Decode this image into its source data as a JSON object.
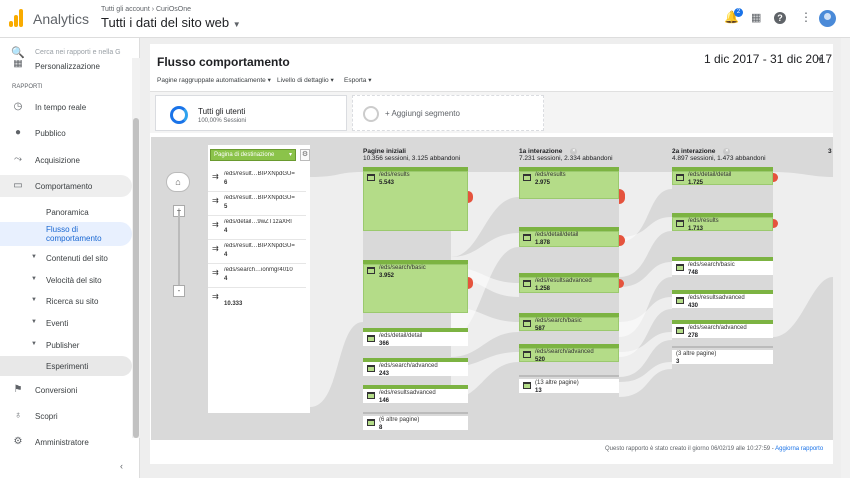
{
  "topbar": {
    "app_name": "Analytics",
    "breadcrumb": "Tutti gli account › CuriOsOne",
    "view_title": "Tutti i dati del sito web",
    "notifications_count": "2"
  },
  "sidebar": {
    "search_placeholder": "Cerca nei rapporti e nella G",
    "personalizzazione": "Personalizzazione",
    "section_label": "RAPPORTI",
    "items": [
      {
        "label": "In tempo reale",
        "icon": "clock-icon"
      },
      {
        "label": "Pubblico",
        "icon": "person-icon"
      },
      {
        "label": "Acquisizione",
        "icon": "acquisition-icon"
      },
      {
        "label": "Comportamento",
        "icon": "behavior-icon"
      }
    ],
    "behavior_sub": [
      "Panoramica",
      "Flusso di comportamento"
    ],
    "behavior_groups": [
      "Contenuti del sito",
      "Velocità del sito",
      "Ricerca su sito",
      "Eventi",
      "Publisher"
    ],
    "experiments": "Esperimenti",
    "bottom_items": [
      {
        "label": "Conversioni",
        "icon": "flag-icon"
      },
      {
        "label": "Scopri",
        "icon": "lightbulb-icon"
      },
      {
        "label": "Amministratore",
        "icon": "gear-icon"
      }
    ]
  },
  "report": {
    "title": "Flusso comportamento",
    "date_range": "1 dic 2017 - 31 dic 2017",
    "options": [
      "Pagine raggruppate automaticamente",
      "Livello di dettaglio",
      "Esporta"
    ],
    "segment_all": "Tutti gli utenti",
    "segment_all_sub": "100,00% Sessioni",
    "segment_add": "+ Aggiungi segmento",
    "dimension_select": "Pagina di destinazione",
    "sources": [
      {
        "name": "/eds/result…BIPXNpdGU=",
        "value": "6"
      },
      {
        "name": "/eds/result…BIPXNpdGU=",
        "value": "5"
      },
      {
        "name": "/eds/detail…9wZT1zaXRl",
        "value": "4"
      },
      {
        "name": "/eds/result…BIPXNpdGU=",
        "value": "4"
      },
      {
        "name": "/eds/search…ionmgr4010",
        "value": "4"
      },
      {
        "name": "",
        "value": "10.333"
      }
    ],
    "columns": [
      {
        "title": "Pagine iniziali",
        "sub": "10.356 sessioni, 3.125 abbandoni"
      },
      {
        "title": "1a interazione",
        "sub": "7.231 sessioni, 2.334 abbandoni"
      },
      {
        "title": "2a interazione",
        "sub": "4.897 sessioni, 1.473 abbandoni"
      },
      {
        "title": "3",
        "sub": ""
      }
    ],
    "col0_nodes": [
      {
        "name": "/eds/results",
        "value": "5.543"
      },
      {
        "name": "/eds/search/basic",
        "value": "3.952"
      },
      {
        "name": "/eds/detail/detail",
        "value": "366"
      },
      {
        "name": "/eds/search/advanced",
        "value": "243"
      },
      {
        "name": "/eds/resultsadvanced",
        "value": "146"
      },
      {
        "name": "(6 altre pagine)",
        "value": "8"
      }
    ],
    "col1_nodes": [
      {
        "name": "/eds/results",
        "value": "2.975"
      },
      {
        "name": "/eds/detail/detail",
        "value": "1.878"
      },
      {
        "name": "/eds/resultsadvanced",
        "value": "1.258"
      },
      {
        "name": "/eds/search/basic",
        "value": "587"
      },
      {
        "name": "/eds/search/advanced",
        "value": "520"
      },
      {
        "name": "(13 altre pagine)",
        "value": "13"
      }
    ],
    "col2_nodes": [
      {
        "name": "/eds/detail/detail",
        "value": "1.725"
      },
      {
        "name": "/eds/results",
        "value": "1.713"
      },
      {
        "name": "/eds/search/basic",
        "value": "748"
      },
      {
        "name": "/eds/resultsadvanced",
        "value": "430"
      },
      {
        "name": "/eds/search/advanced",
        "value": "278"
      },
      {
        "name": "(3 altre pagine)",
        "value": "3"
      }
    ],
    "footer_text": "Questo rapporto è stato creato il giorno 06/02/19 alle 10:27:59 - ",
    "footer_link": "Aggiorna rapporto"
  },
  "colors": {
    "accent": "#1a73e8",
    "node_green": "#b4dc88",
    "drop_red": "#e5533d",
    "brand": "#f9ab00"
  }
}
